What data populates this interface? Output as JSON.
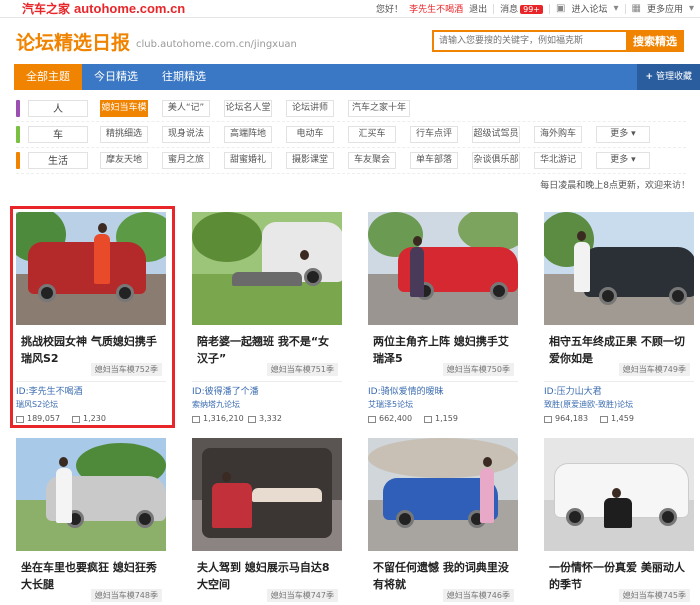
{
  "topbar": {
    "logo_cn": "汽车之家",
    "logo_en": "autohome.com.cn",
    "greeting": "您好！",
    "username": "李先生不喝酒",
    "logout": "退出",
    "messages": "消息",
    "message_count": "99+",
    "forum_entry": "进入论坛",
    "more_apps": "更多应用"
  },
  "header": {
    "title": "论坛精选日报",
    "url": "club.autohome.com.cn/jingxuan",
    "search_placeholder": "请输入您要搜的关键字，例如福克斯",
    "search_button": "搜索精选"
  },
  "nav": {
    "items": [
      "全部主题",
      "今日精选",
      "往期精选"
    ],
    "manage": "管理收藏",
    "manage_plus": "+"
  },
  "categories": [
    {
      "title": "人",
      "color": "#9b4fb0",
      "tags": [
        "媳妇当车模",
        "美人“记”",
        "论坛名人堂",
        "论坛讲师",
        "汽车之家十年"
      ],
      "active": 0
    },
    {
      "title": "车",
      "color": "#7bc043",
      "tags": [
        "精挑细选",
        "现身说法",
        "高端阵地",
        "电动车",
        "汇买车",
        "行车点评",
        "超级试驾员",
        "海外购车",
        "更多"
      ],
      "active": -1
    },
    {
      "title": "生活",
      "color": "#f08300",
      "tags": [
        "摩友天地",
        "蜜月之旅",
        "甜蜜婚礼",
        "摄影课堂",
        "车友聚会",
        "单车部落",
        "杂谈俱乐部",
        "华北游记",
        "更多"
      ],
      "active": -1
    }
  ],
  "update_note": "每日凌晨和晚上8点更新，欢迎来访！",
  "cards": [
    {
      "title": "挑战校园女神 气质媳妇携手瑞风S2",
      "source": "媳妇当车模752季",
      "user": "ID:李先生不喝酒",
      "forum": "瑞风S2论坛",
      "views": "189,057",
      "replies": "1,230"
    },
    {
      "title": "陪老婆一起翘班 我不是“女汉子”",
      "source": "媳妇当车模751季",
      "user": "ID:彼得潘了个潘",
      "forum": "索纳塔九论坛",
      "views": "1,316,210",
      "replies": "3,332"
    },
    {
      "title": "两位主角齐上阵 媳妇携手艾瑞泽5",
      "source": "媳妇当车模750季",
      "user": "ID:骑似爱情的暧昧",
      "forum": "艾瑞泽5论坛",
      "views": "662,400",
      "replies": "1,159"
    },
    {
      "title": "相守五年终成正果 不顾一切爱你如是",
      "source": "媳妇当车模749季",
      "user": "ID:压力山大君",
      "forum": "致胜(原爱迪欧-致胜)论坛",
      "views": "964,183",
      "replies": "1,459"
    },
    {
      "title": "坐在车里也要疯狂 媳妇狂秀大长腿",
      "source": "媳妇当车模748季"
    },
    {
      "title": "夫人驾到 媳妇展示马自达8大空间",
      "source": "媳妇当车模747季"
    },
    {
      "title": "不留任何遗憾 我的词典里没有将就",
      "source": "媳妇当车模746季"
    },
    {
      "title": "一份情怀一份真爱 美丽动人的季节",
      "source": "媳妇当车模745季"
    }
  ]
}
